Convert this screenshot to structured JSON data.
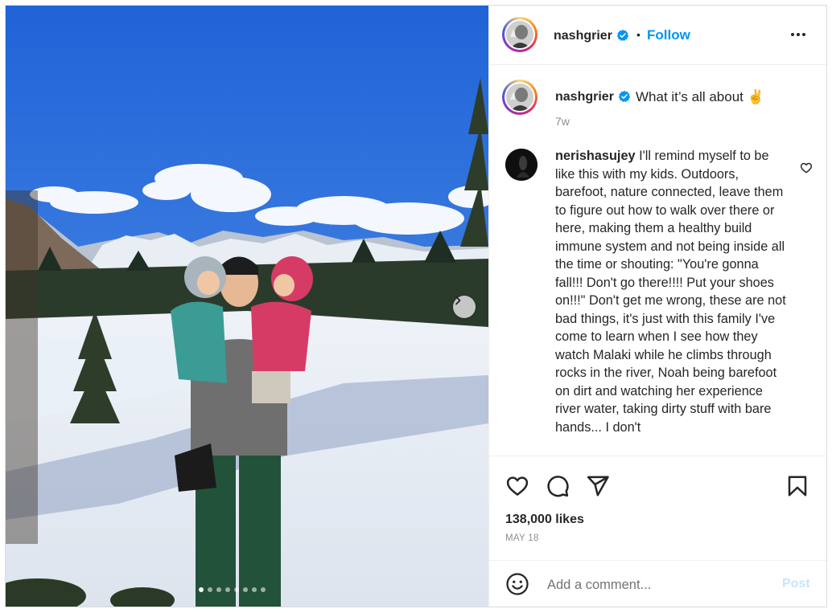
{
  "post": {
    "username": "nashgrier",
    "follow_label": "Follow",
    "bullet": "•",
    "caption_text": "What it’s all about ✌️",
    "caption_time": "7w",
    "likes": "138,000 likes",
    "date": "MAY 18",
    "carousel_dots": 8,
    "active_dot": 0
  },
  "comment": {
    "username": "nerishasujey",
    "text": "I'll remind myself to be like this with my kids. Outdoors, barefoot, nature connected, leave them to figure out how to walk over there or here, making them a healthy build immune system and not being inside all the time or shouting: \"You're gonna fall!!! Don't go there!!!! Put your shoes on!!!\" Don't get me wrong, these are not bad things, it's just with this family I've come to learn when I see how they watch Malaki while he climbs through rocks in the river, Noah being barefoot on dirt and watching her experience river water, taking dirty stuff with bare hands... I don't"
  },
  "add_comment": {
    "placeholder": "Add a comment...",
    "post_label": "Post"
  },
  "colors": {
    "link_blue": "#0095f6",
    "post_disabled": "#c7e5fc",
    "muted": "#8e8e8e",
    "verified_blue": "#0095f6"
  },
  "icons": {
    "more": "more-horizontal-icon",
    "like": "heart-icon",
    "comment": "comment-icon",
    "share": "paper-plane-icon",
    "save": "bookmark-icon",
    "emoji": "emoji-icon",
    "next": "chevron-right-icon",
    "verified": "verified-badge-icon"
  }
}
